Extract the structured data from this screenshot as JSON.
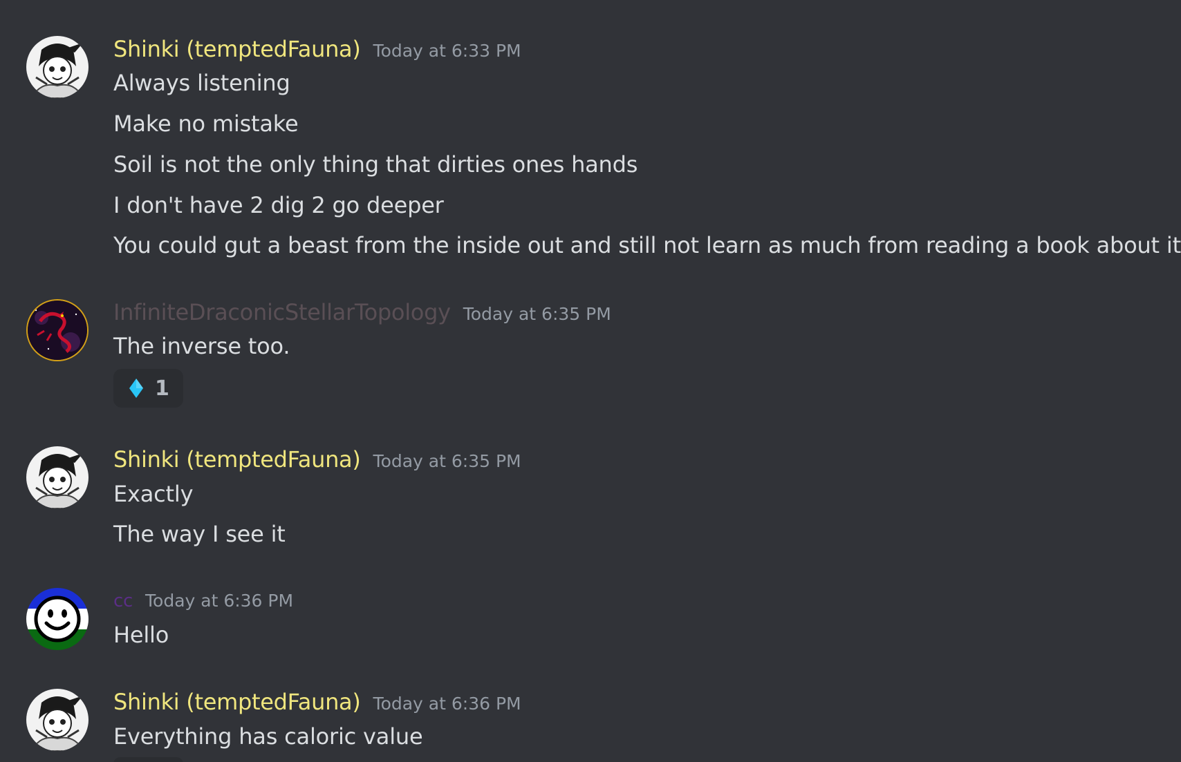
{
  "colors": {
    "background": "#313338",
    "shinki_name": "#f0e67e",
    "infinite_name": "#5a4f55",
    "cc_name": "#5b2e86",
    "text": "#dbdee1",
    "timestamp": "#949ba4",
    "reaction_gem": "#29c5f6"
  },
  "messages": [
    {
      "author": "Shinki (temptedFauna)",
      "timestamp": "Today at 6:33 PM",
      "avatar": "manga-character-avatar",
      "lines": [
        "Always listening",
        "Make no mistake",
        "Soil is not the only thing that dirties ones hands",
        "I don't have 2 dig 2 go deeper",
        "You could gut a beast from the inside out and still not learn as much from reading a book about it"
      ]
    },
    {
      "author": "InfiniteDraconicStellarTopology",
      "timestamp": "Today at 6:35 PM",
      "avatar": "dragon-avatar",
      "lines": [
        "The inverse too."
      ],
      "reaction": {
        "icon": "blue-diamond-icon",
        "count": "1"
      }
    },
    {
      "author": "Shinki (temptedFauna)",
      "timestamp": "Today at 6:35 PM",
      "avatar": "manga-character-avatar",
      "lines": [
        "Exactly",
        "The way I see it"
      ]
    },
    {
      "author": "cc",
      "timestamp": "Today at 6:36 PM",
      "avatar": "smiley-flag-avatar",
      "lines": [
        "Hello"
      ]
    },
    {
      "author": "Shinki (temptedFauna)",
      "timestamp": "Today at 6:36 PM",
      "avatar": "manga-character-avatar",
      "lines": [
        "Everything has caloric value"
      ]
    }
  ]
}
